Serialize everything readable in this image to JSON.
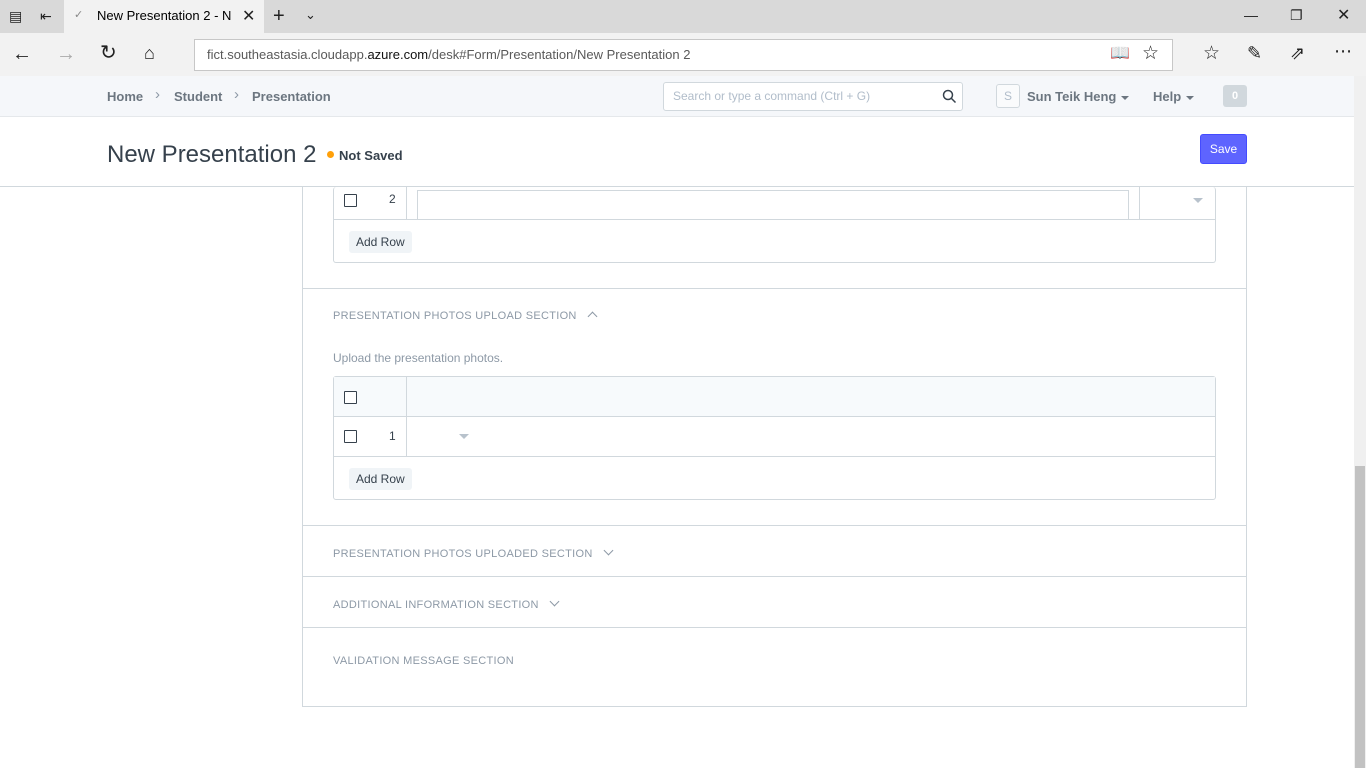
{
  "browser": {
    "tab_title": "New Presentation 2 - N",
    "url_prefix": "fict.southeastasia.cloudapp.",
    "url_domain": "azure.com",
    "url_suffix": "/desk#Form/Presentation/New Presentation 2"
  },
  "breadcrumb": [
    "Home",
    "Student",
    "Presentation"
  ],
  "search": {
    "placeholder": "Search or type a command (Ctrl + G)"
  },
  "user": {
    "avatar_letter": "S",
    "name": "Sun Teik Heng"
  },
  "help_label": "Help",
  "notifications_count": "0",
  "page": {
    "title": "New Presentation 2",
    "status": "Not Saved",
    "save_label": "Save"
  },
  "top_grid": {
    "row_index": "2",
    "add_row_label": "Add Row"
  },
  "sections": {
    "upload": {
      "heading": "PRESENTATION PHOTOS UPLOAD SECTION",
      "description": "Upload the presentation photos.",
      "row_index": "1",
      "add_row_label": "Add Row"
    },
    "uploaded": {
      "heading": "PRESENTATION PHOTOS UPLOADED SECTION"
    },
    "additional": {
      "heading": "ADDITIONAL INFORMATION SECTION"
    },
    "validation": {
      "heading": "VALIDATION MESSAGE SECTION"
    }
  },
  "colors": {
    "accent": "#5e64ff",
    "status_dot": "#ffa00a"
  }
}
